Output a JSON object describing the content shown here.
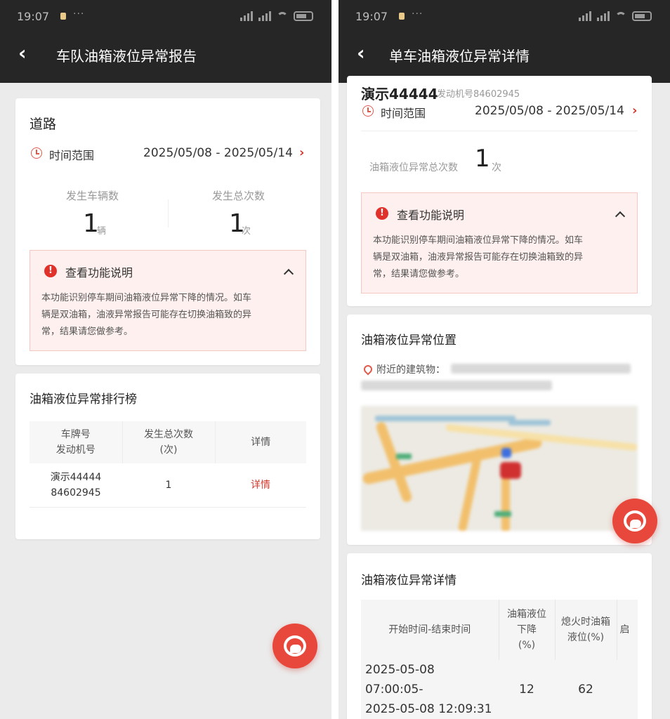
{
  "status": {
    "time": "19:07",
    "more": "···"
  },
  "left": {
    "nav_title": "车队油箱液位异常报告",
    "summary": {
      "title": "道路",
      "time_label": "时间范围",
      "time_range": "2025/05/08 - 2025/05/14",
      "vehicles_label": "发生车辆数",
      "vehicles_value": "1",
      "vehicles_unit": "辆",
      "times_label": "发生总次数",
      "times_value": "1",
      "times_unit": "次"
    },
    "notice": {
      "title": "查看功能说明",
      "line1": "本功能识别停车期间油箱液位异常下降的情况。如车",
      "line2": "辆是双油箱，油液异常报告可能存在切换油箱致的异",
      "line3": "常，结果请您做参考。"
    },
    "ranking": {
      "title": "油箱液位异常排行榜",
      "col1_line1": "车牌号",
      "col1_line2": "发动机号",
      "col2_line1": "发生总次数",
      "col2_line2": "(次)",
      "col3": "详情",
      "rows": [
        {
          "plate": "演示44444",
          "engine": "84602945",
          "count": "1",
          "detail": "详情"
        }
      ]
    }
  },
  "right": {
    "nav_title": "单车油箱液位异常详情",
    "vehicle": {
      "plate": "演示44444",
      "engine_label": "发动机号84602945",
      "time_label": "时间范围",
      "time_range": "2025/05/08 - 2025/05/14",
      "total_label": "油箱液位异常总次数",
      "total_value": "1",
      "total_unit": "次"
    },
    "notice": {
      "title": "查看功能说明",
      "line1": "本功能识别停车期间油箱液位异常下降的情况。如车",
      "line2": "辆是双油箱，油液异常报告可能存在切换油箱致的异",
      "line3": "常，结果请您做参考。"
    },
    "location": {
      "title": "油箱液位异常位置",
      "nearby_label": "附近的建筑物："
    },
    "detail": {
      "title": "油箱液位异常详情",
      "col1": "开始时间-结束时间",
      "col2_line1": "油箱液位",
      "col2_line2": "下降",
      "col2_line3": "(%)",
      "col3_line1": "熄火时油箱",
      "col3_line2": "液位(%)",
      "col4": "启",
      "row_start_date": "2025-05-08",
      "row_start_time": "07:00:05-",
      "row_end": "2025-05-08 12:09:31",
      "row_drop": "12",
      "row_level": "62"
    }
  },
  "colors": {
    "accent_red": "#d23a2e",
    "topbar": "#262626",
    "notice_bg": "#fdf0ee",
    "fab": "#e8483c"
  },
  "icons": [
    "back-arrow-icon",
    "clock-icon",
    "chevron-right-icon",
    "warning-icon",
    "chevron-up-icon",
    "location-pin-icon",
    "customer-service-icon"
  ]
}
